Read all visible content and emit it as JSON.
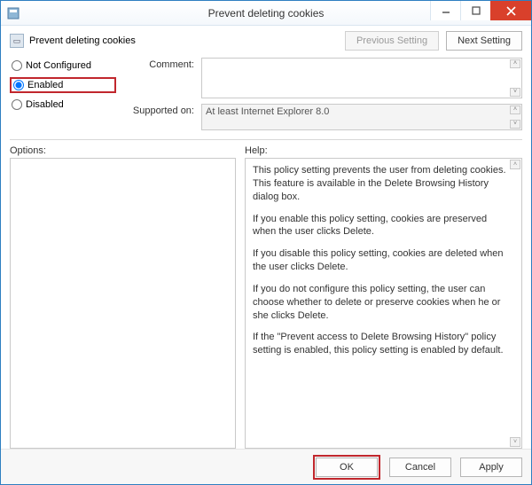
{
  "window": {
    "title": "Prevent deleting cookies"
  },
  "header": {
    "setting_name": "Prevent deleting cookies",
    "prev_btn": "Previous Setting",
    "next_btn": "Next Setting"
  },
  "state": {
    "options": [
      {
        "label": "Not Configured",
        "checked": false
      },
      {
        "label": "Enabled",
        "checked": true
      },
      {
        "label": "Disabled",
        "checked": false
      }
    ],
    "selected_index": 1
  },
  "comment": {
    "label": "Comment:",
    "value": ""
  },
  "supported": {
    "label": "Supported on:",
    "value": "At least Internet Explorer 8.0"
  },
  "options_pane": {
    "label": "Options:"
  },
  "help_pane": {
    "label": "Help:",
    "paragraphs": [
      "This policy setting prevents the user from deleting cookies. This feature is available in the Delete Browsing History dialog box.",
      "If you enable this policy setting, cookies are preserved when the user clicks Delete.",
      "If you disable this policy setting, cookies are deleted when the user clicks Delete.",
      "If you do not configure this policy setting, the user can choose whether to delete or preserve cookies when he or she clicks Delete.",
      "If the \"Prevent access to Delete Browsing History\" policy setting is enabled, this policy setting is enabled by default."
    ]
  },
  "footer": {
    "ok": "OK",
    "cancel": "Cancel",
    "apply": "Apply"
  }
}
